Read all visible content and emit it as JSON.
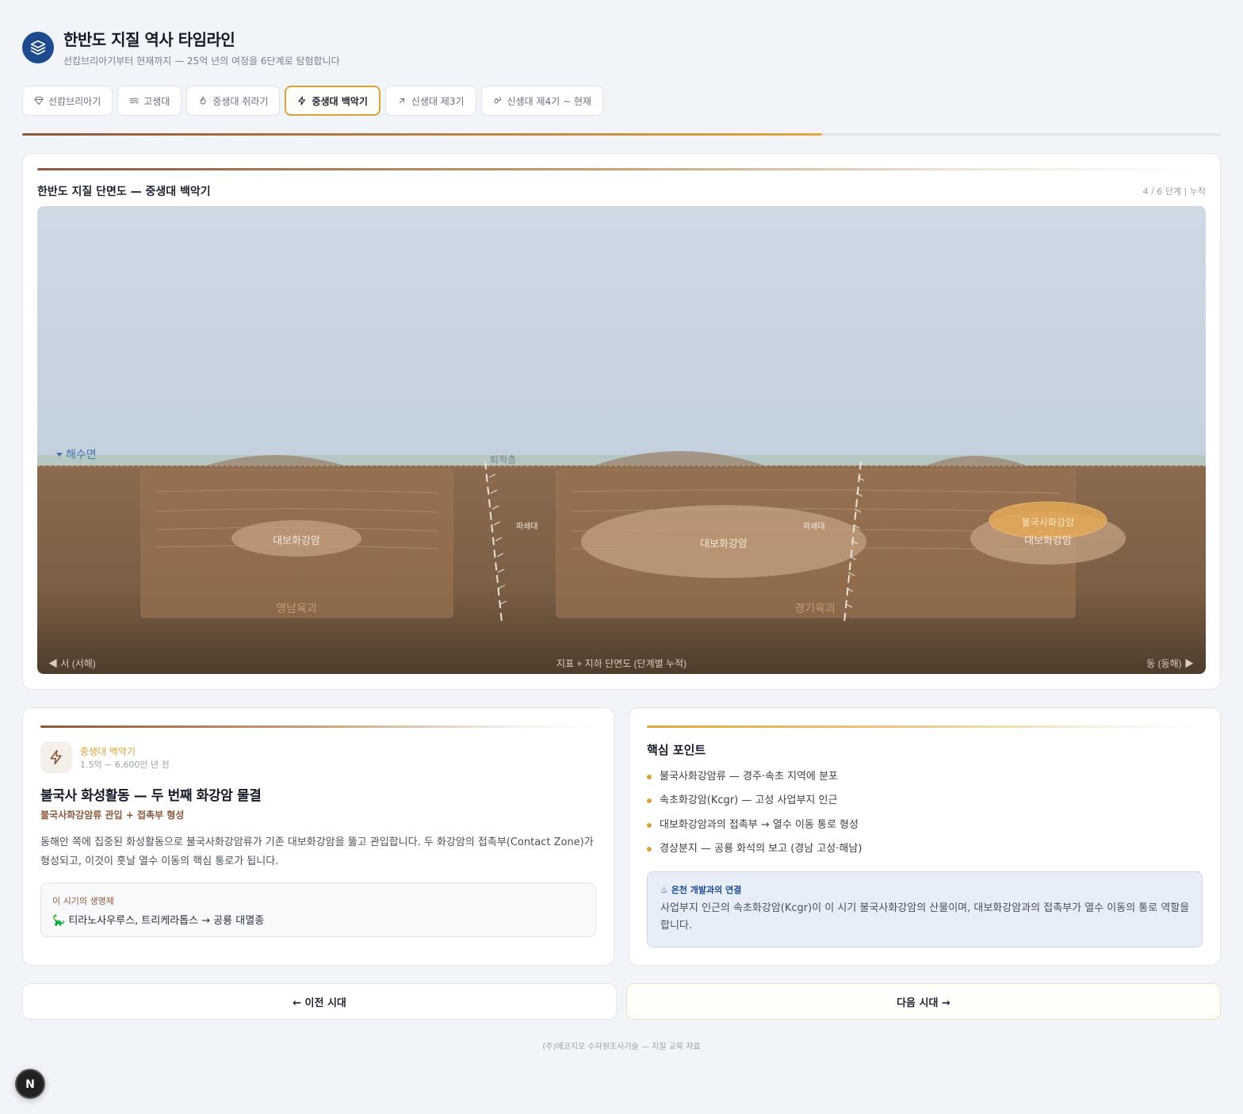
{
  "header": {
    "title": "한반도 지질 역사 타임라인",
    "subtitle": "선캄브리아기부터 현재까지 — 25억 년의 여정을 6단계로 탐험합니다",
    "logo_icon": "layers-icon"
  },
  "tabs": [
    {
      "label": "선캄브리아기",
      "icon": "gem-icon"
    },
    {
      "label": "고생대",
      "icon": "waves-icon"
    },
    {
      "label": "중생대 쥐라기",
      "icon": "flame-icon"
    },
    {
      "label": "중생대 백악기",
      "icon": "zap-icon",
      "active": true
    },
    {
      "label": "신생대 제3기",
      "icon": "arrow-up-right-icon"
    },
    {
      "label": "신생대 제4기 ~ 현재",
      "icon": "droplets-icon"
    }
  ],
  "progress": {
    "current": 4,
    "total": 6,
    "fraction": 0.667
  },
  "section": {
    "title": "한반도 지질 단면도 — 중생대 백악기",
    "meta": "4 / 6 단계 | 누적"
  },
  "diagram": {
    "sea_level": "해수면",
    "sediment": "퇴적층",
    "fault_left": "파쇄대",
    "fault_right": "파쇄대",
    "granite_1": "대보화강암",
    "granite_2": "대보화강암",
    "granite_3": "대보화강암",
    "bulguksa": "불국사화강암",
    "massif_west": "영남육괴",
    "massif_east": "경기육괴",
    "west": "◀ 서 (서해)",
    "center": "지표 + 지하 단면도 (단계별 누적)",
    "east": "동 (동해) ▶"
  },
  "era": {
    "icon": "zap-icon",
    "name": "중생대 백악기",
    "range": "1.5억 ~ 6,600만 년 전",
    "title": "불국사 화성활동 — 두 번째 화강암 물결",
    "subtitle": "불국사화강암류 관입 + 접촉부 형성",
    "description": "동해안 쪽에 집중된 화성활동으로 불국사화강암류가 기존 대보화강암을 뚫고 관입합니다. 두 화강암의 접촉부(Contact Zone)가 형성되고, 이것이 훗날 열수 이동의 핵심 통로가 됩니다.",
    "life_label": "이 시기의 생명체",
    "life_text": "🦕 티라노사우루스, 트리케라톱스 → 공룡 대멸종"
  },
  "points": {
    "title": "핵심 포인트",
    "items": [
      "불국사화강암류 — 경주·속초 지역에 분포",
      "속초화강암(Kcgr) — 고성 사업부지 인근",
      "대보화강암과의 접촉부 → 열수 이동 통로 형성",
      "경상분지 — 공룡 화석의 보고 (경남 고성·해남)"
    ],
    "connection_title": "♨ 온천 개발과의 연결",
    "connection_text": "사업부지 인근의 속초화강암(Kcgr)이 이 시기 불국사화강암의 산물이며, 대보화강암과의 접촉부가 열수 이동의 통로 역할을 합니다."
  },
  "nav": {
    "prev": "← 이전 시대",
    "next": "다음 시대 →"
  },
  "footer": "(주)에코지오 수자원조사기술 — 지질 교육 자료",
  "badge": "N",
  "colors": {
    "accent": "#d9a23b",
    "brown": "#8b5a3c",
    "navy": "#1e4b8f"
  }
}
